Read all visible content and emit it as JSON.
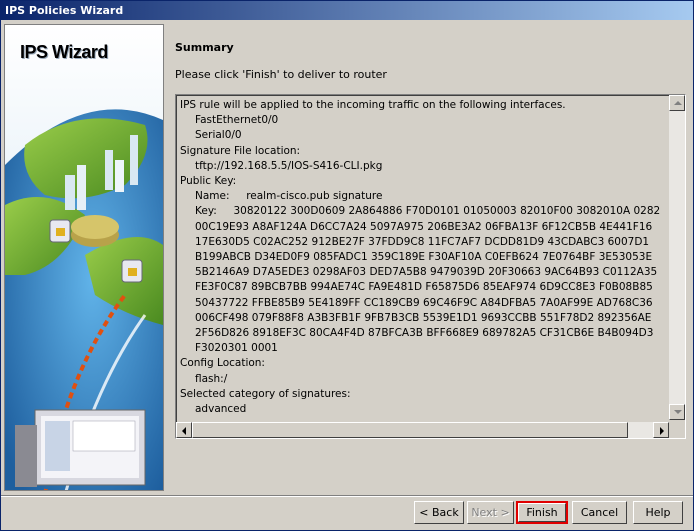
{
  "window": {
    "title": "IPS Policies Wizard"
  },
  "left_panel": {
    "wizard_title": "IPS Wizard"
  },
  "summary": {
    "heading": "Summary",
    "instruction": "Please click 'Finish' to deliver to router",
    "lines": [
      {
        "text": "IPS rule will be applied to the incoming traffic on the following interfaces.",
        "indent": false
      },
      {
        "text": "FastEthernet0/0",
        "indent": true
      },
      {
        "text": "Serial0/0",
        "indent": true
      },
      {
        "text": "Signature File location:",
        "indent": false
      },
      {
        "text": "tftp://192.168.5.5/IOS-S416-CLI.pkg",
        "indent": true
      },
      {
        "text": "Public Key:",
        "indent": false
      },
      {
        "text": "Name:     realm-cisco.pub signature",
        "indent": true
      },
      {
        "text": "Key:     30820122 300D0609 2A864886 F70D0101 01050003 82010F00 3082010A 0282",
        "indent": true
      },
      {
        "text": "00C19E93 A8AF124A D6CC7A24 5097A975 206BE3A2 06FBA13F 6F12CB5B 4E441F16",
        "indent": true
      },
      {
        "text": "17E630D5 C02AC252 912BE27F 37FDD9C8 11FC7AF7 DCDD81D9 43CDABC3 6007D1",
        "indent": true
      },
      {
        "text": "B199ABCB D34ED0F9 085FADC1 359C189E F30AF10A C0EFB624 7E0764BF 3E53053E",
        "indent": true
      },
      {
        "text": "5B2146A9 D7A5EDE3 0298AF03 DED7A5B8 9479039D 20F30663 9AC64B93 C0112A35",
        "indent": true
      },
      {
        "text": "FE3F0C87 89BCB7BB 994AE74C FA9E481D F65875D6 85EAF974 6D9CC8E3 F0B08B85",
        "indent": true
      },
      {
        "text": "50437722 FFBE85B9 5E4189FF CC189CB9 69C46F9C A84DFBA5 7A0AF99E AD768C36",
        "indent": true
      },
      {
        "text": "006CF498 079F88F8 A3B3FB1F 9FB7B3CB 5539E1D1 9693CCBB 551F78D2 892356AE",
        "indent": true
      },
      {
        "text": "2F56D826 8918EF3C 80CA4F4D 87BFCA3B BFF668E9 689782A5 CF31CB6E B4B094D3",
        "indent": true
      },
      {
        "text": "F3020301 0001",
        "indent": true
      },
      {
        "text": "Config Location:",
        "indent": false
      },
      {
        "text": "flash:/",
        "indent": true
      },
      {
        "text": "Selected category of signatures:",
        "indent": false
      },
      {
        "text": "advanced",
        "indent": true
      }
    ]
  },
  "buttons": {
    "back": "< Back",
    "next": "Next >",
    "finish": "Finish",
    "cancel": "Cancel",
    "help": "Help"
  }
}
